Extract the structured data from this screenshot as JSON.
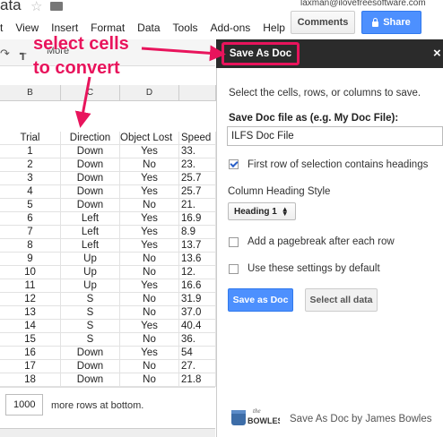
{
  "header": {
    "doc_title": "ata",
    "email": "laxman@ilovefreesoftware.com",
    "comments_label": "Comments",
    "share_label": "Share",
    "menus": [
      "t",
      "View",
      "Insert",
      "Format",
      "Data",
      "Tools",
      "Add-ons",
      "Help"
    ],
    "toolbar_more": "More"
  },
  "annotations": {
    "line1": "select cells",
    "line2": "to convert"
  },
  "grid": {
    "col_headers": [
      "B",
      "C",
      "D",
      ""
    ],
    "header_row": [
      "Trial",
      "Direction",
      "Object Lost",
      "Speed"
    ],
    "rows": [
      [
        "1",
        "Down",
        "Yes",
        "33."
      ],
      [
        "2",
        "Down",
        "No",
        "23."
      ],
      [
        "3",
        "Down",
        "Yes",
        "25.7"
      ],
      [
        "4",
        "Down",
        "Yes",
        "25.7"
      ],
      [
        "5",
        "Down",
        "No",
        "21."
      ],
      [
        "6",
        "Left",
        "Yes",
        "16.9"
      ],
      [
        "7",
        "Left",
        "Yes",
        "8.9"
      ],
      [
        "8",
        "Left",
        "Yes",
        "13.7"
      ],
      [
        "9",
        "Up",
        "No",
        "13.6"
      ],
      [
        "10",
        "Up",
        "No",
        "12."
      ],
      [
        "11",
        "Up",
        "Yes",
        "16.6"
      ],
      [
        "12",
        "S",
        "No",
        "31.9"
      ],
      [
        "13",
        "S",
        "No",
        "37.0"
      ],
      [
        "14",
        "S",
        "Yes",
        "40.4"
      ],
      [
        "15",
        "S",
        "No",
        "36."
      ],
      [
        "16",
        "Down",
        "Yes",
        "54"
      ],
      [
        "17",
        "Down",
        "No",
        "27."
      ],
      [
        "18",
        "Down",
        "No",
        "21.8"
      ]
    ],
    "rows_to_add": "1000",
    "rows_label": "more rows at bottom."
  },
  "sidebar": {
    "title": "Save As Doc",
    "instructions": "Select the cells, rows, or columns to save.",
    "file_label": "Save Doc file as (e.g. My Doc File):",
    "file_value": "ILFS Doc File",
    "first_row_label": "First row of selection contains headings",
    "first_row_checked": true,
    "heading_style_label": "Column Heading Style",
    "heading_style_value": "Heading 1",
    "pagebreak_label": "Add a pagebreak after each row",
    "pagebreak_checked": false,
    "default_label": "Use these settings by default",
    "default_checked": false,
    "save_button": "Save as Doc",
    "select_all_button": "Select all data",
    "logo_text": "BOWLES",
    "logo_small": "the",
    "footer": "Save As Doc by James Bowles"
  },
  "colors": {
    "accent_pink": "#e8145c",
    "blue_button": "#4d90fe",
    "sidebar_header": "#2b2b2b"
  }
}
